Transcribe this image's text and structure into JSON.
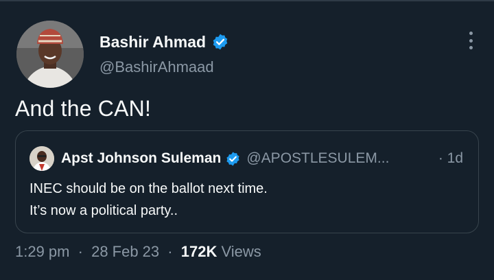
{
  "author": {
    "display_name": "Bashir Ahmad",
    "handle": "@BashirAhmaad",
    "verified": true
  },
  "tweet": {
    "text": "And the CAN!"
  },
  "quoted_tweet": {
    "display_name": "Apst Johnson Suleman",
    "handle": "@APOSTLESULEM...",
    "time": "· 1d",
    "line1": "INEC should be on the ballot next time.",
    "line2": "It’s now a political party.."
  },
  "meta": {
    "time": "1:29 pm",
    "date": "28 Feb 23",
    "views_count": "172K",
    "views_label": "Views",
    "separator": "·"
  },
  "colors": {
    "background": "#15202b",
    "verified": "#1d9bf0",
    "secondary_text": "#8b98a5",
    "border": "#38444d"
  },
  "icons": {
    "verified": "verified-badge-icon",
    "more": "more-options-icon"
  }
}
